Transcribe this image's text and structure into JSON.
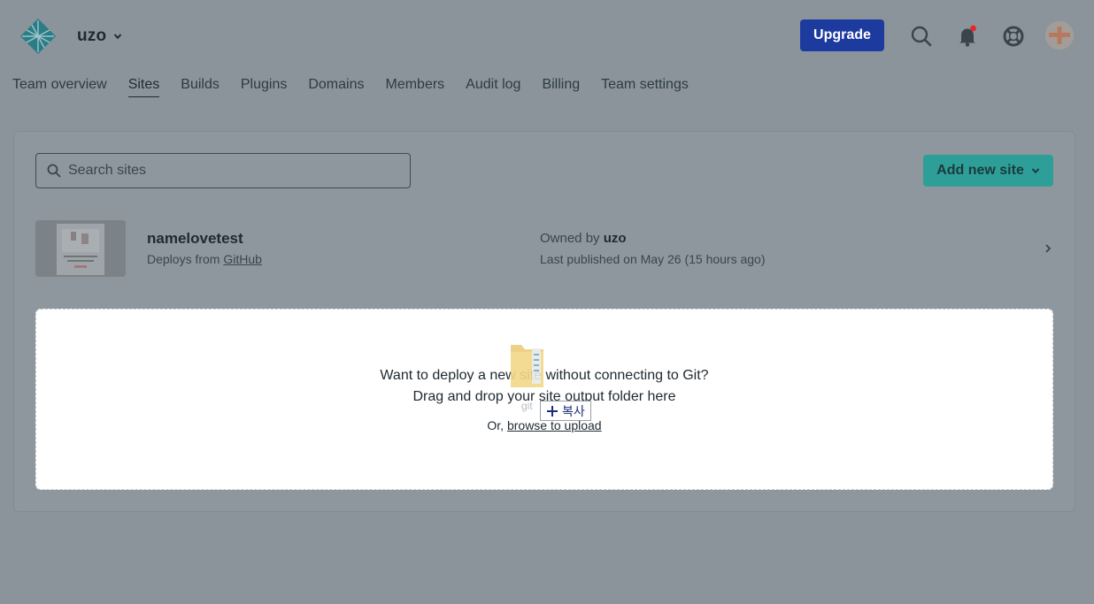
{
  "header": {
    "team_name": "uzo",
    "upgrade_label": "Upgrade",
    "icons": [
      "netlify-logo-icon",
      "search-icon",
      "bell-icon",
      "help-lifebuoy-icon",
      "user-avatar"
    ],
    "colors": {
      "upgrade": "#1d3a9e",
      "accent": "#2e9f98",
      "notification_dot": "#e6262e"
    }
  },
  "nav": {
    "items": [
      {
        "label": "Team overview",
        "active": false
      },
      {
        "label": "Sites",
        "active": true
      },
      {
        "label": "Builds",
        "active": false
      },
      {
        "label": "Plugins",
        "active": false
      },
      {
        "label": "Domains",
        "active": false
      },
      {
        "label": "Members",
        "active": false
      },
      {
        "label": "Audit log",
        "active": false
      },
      {
        "label": "Billing",
        "active": false
      },
      {
        "label": "Team settings",
        "active": false
      }
    ]
  },
  "sites": {
    "search_placeholder": "Search sites",
    "add_new_label": "Add new site",
    "list": [
      {
        "name": "namelovetest",
        "deploys_prefix": "Deploys from ",
        "deploys_source": "GitHub",
        "owned_prefix": "Owned by ",
        "owner": "uzo",
        "published": "Last published on May 26 (15 hours ago)"
      }
    ]
  },
  "dropzone": {
    "line1": "Want to deploy a new site without connecting to Git?",
    "line2": "Drag and drop your site output folder here",
    "or_prefix": "Or, ",
    "browse_label": "browse to upload"
  },
  "drag_overlay": {
    "ghost_text": "git",
    "copy_label": "복사"
  }
}
